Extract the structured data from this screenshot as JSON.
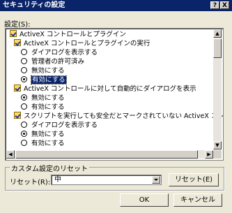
{
  "window": {
    "title": "セキュリティの設定",
    "help_label": "?",
    "close_label": "X"
  },
  "settings_label": "設定(S):",
  "tree": [
    {
      "kind": "category",
      "label": "ActiveX コントロールとプラグイン"
    },
    {
      "kind": "category",
      "label": "ActiveX コントロールとプラグインの実行"
    },
    {
      "kind": "option",
      "label": "ダイアログを表示する",
      "checked": false
    },
    {
      "kind": "option",
      "label": "管理者の許可済み",
      "checked": false
    },
    {
      "kind": "option",
      "label": "無効にする",
      "checked": false
    },
    {
      "kind": "option",
      "label": "有効にする",
      "checked": true,
      "selected": true
    },
    {
      "kind": "category",
      "label": "ActiveX コントロールに対して自動的にダイアログを表示"
    },
    {
      "kind": "option",
      "label": "無効にする",
      "checked": true
    },
    {
      "kind": "option",
      "label": "有効にする",
      "checked": false
    },
    {
      "kind": "category",
      "label": "スクリプトを実行しても安全だとマークされていない ActiveX コントロー"
    },
    {
      "kind": "option",
      "label": "ダイアログを表示する",
      "checked": false
    },
    {
      "kind": "option",
      "label": "無効にする",
      "checked": true
    },
    {
      "kind": "option",
      "label": "有効にする",
      "checked": false
    }
  ],
  "scroll": {
    "up": "▲",
    "down": "▼",
    "left": "◀",
    "right": "▶"
  },
  "custom_reset": {
    "group_title": "カスタム設定のリセット",
    "reset_to_label": "リセット(R):",
    "reset_value": "中",
    "reset_button": "リセット(E)"
  },
  "footer": {
    "ok": "OK",
    "cancel": "キャンセル"
  }
}
